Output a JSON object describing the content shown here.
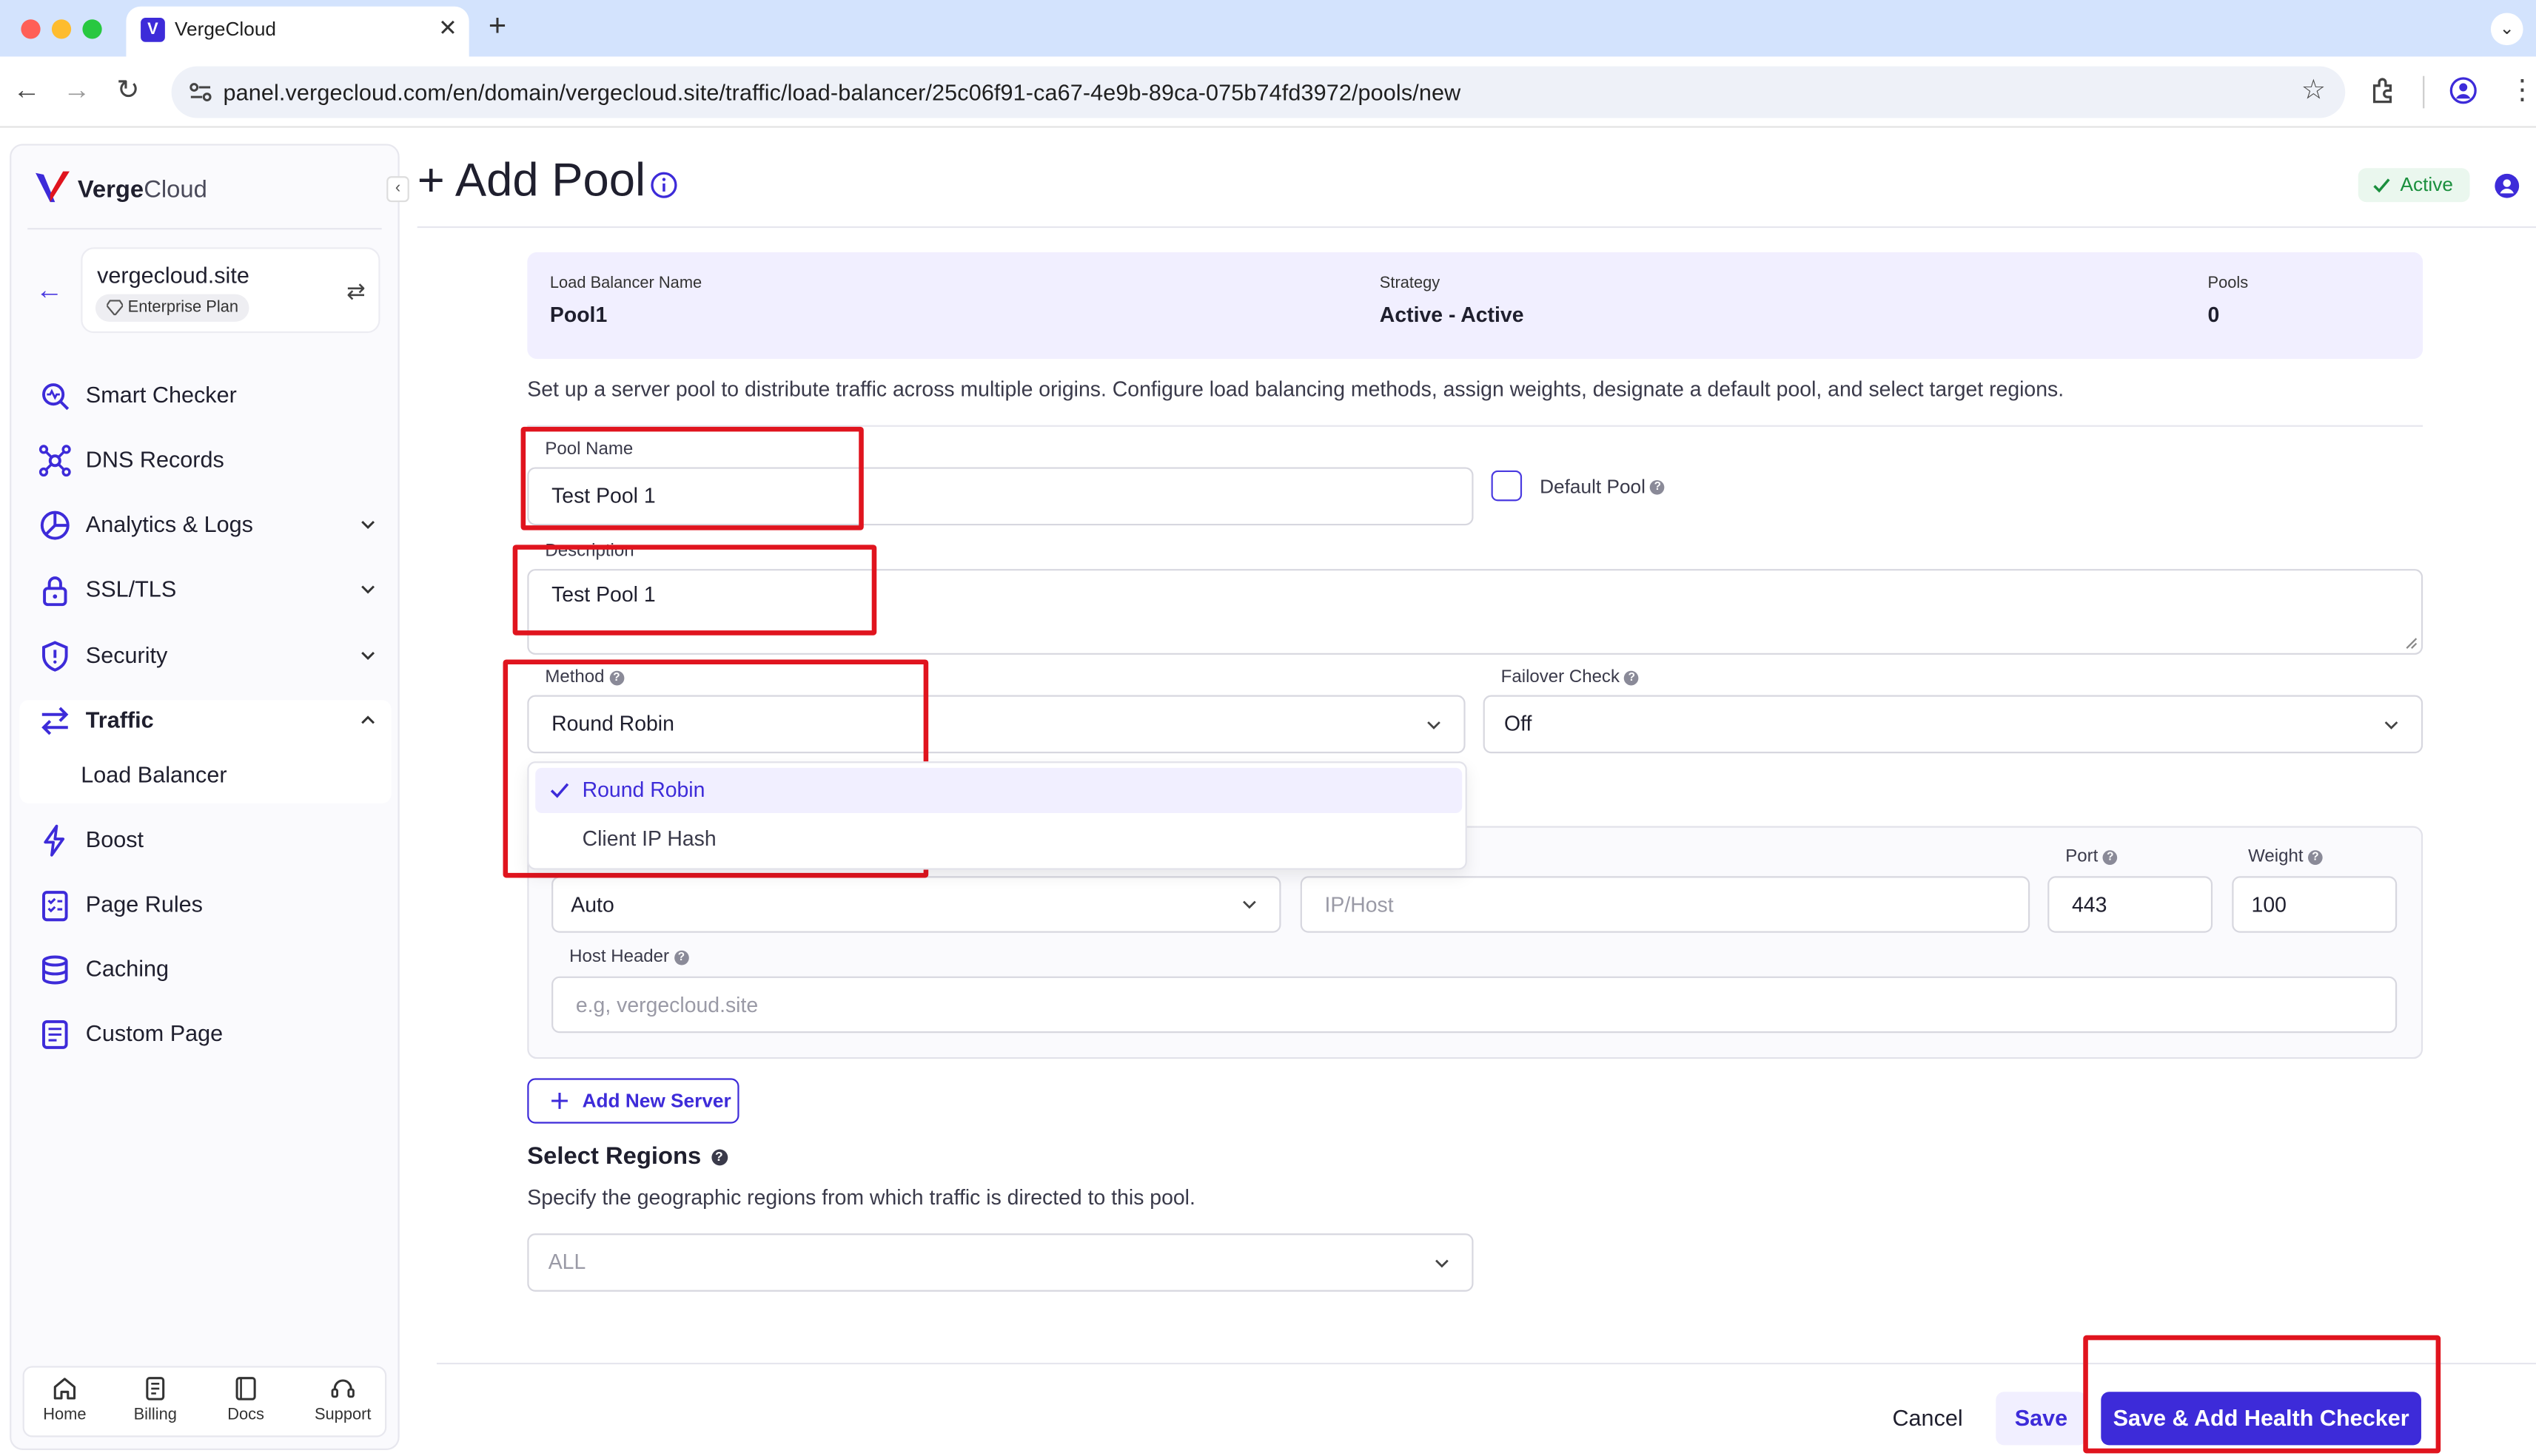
{
  "browser": {
    "tab_title": "VergeCloud",
    "tab_logo_letter": "V",
    "url": "panel.vergecloud.com/en/domain/vergecloud.site/traffic/load-balancer/25c06f91-ca67-4e9b-89ca-075b74fd3972/pools/new",
    "close_glyph": "✕",
    "new_tab_glyph": "+",
    "menu_glyph": "⌄",
    "back_glyph": "←",
    "forward_glyph": "→",
    "reload_glyph": "↻",
    "star_glyph": "☆",
    "more_glyph": "⋮"
  },
  "sidebar": {
    "brand_bold": "Verge",
    "brand_light": "Cloud",
    "collapse_glyph": "‹",
    "back_glyph": "←",
    "swap_glyph": "⇄",
    "domain": "vergecloud.site",
    "plan": "Enterprise Plan",
    "items": [
      {
        "label": "Smart Checker",
        "icon": "smart-checker-icon"
      },
      {
        "label": "DNS Records",
        "icon": "dns-icon"
      },
      {
        "label": "Analytics & Logs",
        "icon": "analytics-icon"
      },
      {
        "label": "SSL/TLS",
        "icon": "lock-icon"
      },
      {
        "label": "Security",
        "icon": "shield-icon"
      },
      {
        "label": "Traffic",
        "icon": "traffic-icon"
      },
      {
        "label": "Boost",
        "icon": "bolt-icon"
      },
      {
        "label": "Page Rules",
        "icon": "page-rules-icon"
      },
      {
        "label": "Caching",
        "icon": "database-icon"
      },
      {
        "label": "Custom Page",
        "icon": "custom-page-icon"
      }
    ],
    "sub_item": "Load Balancer",
    "bottom": [
      {
        "label": "Home",
        "icon": "home-icon"
      },
      {
        "label": "Billing",
        "icon": "billing-icon"
      },
      {
        "label": "Docs",
        "icon": "docs-icon"
      },
      {
        "label": "Support",
        "icon": "support-icon"
      }
    ]
  },
  "header": {
    "title": "+ Add Pool",
    "status": "Active"
  },
  "summary": {
    "lb_name_label": "Load Balancer Name",
    "lb_name_value": "Pool1",
    "strategy_label": "Strategy",
    "strategy_value": "Active - Active",
    "pools_label": "Pools",
    "pools_value": "0"
  },
  "intro": "Set up a server pool to distribute traffic across multiple origins. Configure load balancing methods, assign weights, designate a default pool, and select target regions.",
  "form": {
    "pool_name_label": "Pool Name",
    "pool_name_value": "Test Pool 1",
    "default_pool_label": "Default Pool",
    "description_label": "Description",
    "description_value": "Test Pool 1",
    "method_label": "Method",
    "method_value": "Round Robin",
    "method_options": [
      "Round Robin",
      "Client IP Hash"
    ],
    "failover_label": "Failover Check",
    "failover_value": "Off",
    "server_type_value": "Auto",
    "ip_host_placeholder": "IP/Host",
    "port_label": "Port",
    "port_value": "443",
    "weight_label": "Weight",
    "weight_value": "100",
    "host_header_label": "Host Header",
    "host_header_placeholder": "e.g, vergecloud.site",
    "add_server_label": "Add New Server",
    "regions_title": "Select Regions",
    "regions_desc": "Specify the geographic regions from which traffic is directed to this pool.",
    "regions_value": "ALL"
  },
  "footer": {
    "cancel": "Cancel",
    "save": "Save",
    "save_health": "Save & Add Health Checker"
  },
  "colors": {
    "accent": "#3d2bd9",
    "highlight_box": "#e0141e",
    "active_green": "#1a8f3d"
  }
}
